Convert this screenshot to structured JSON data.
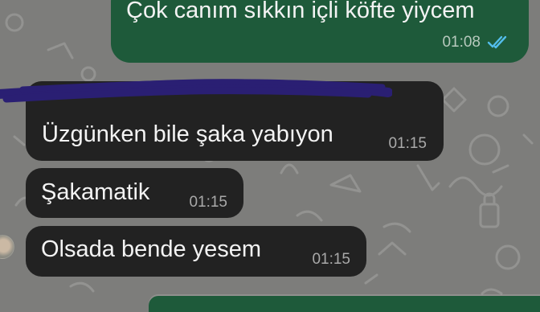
{
  "chat": {
    "messages": [
      {
        "direction": "outgoing",
        "text": "Çok canım sıkkın içli köfte yiycem",
        "time": "01:08",
        "status": "read"
      },
      {
        "direction": "incoming",
        "text": "Üzgünken bile şaka yabıyon",
        "time": "01:15"
      },
      {
        "direction": "incoming",
        "text": "Şakamatik",
        "time": "01:15"
      },
      {
        "direction": "incoming",
        "text": "Olsada bende yesem",
        "time": "01:15"
      }
    ]
  },
  "colors": {
    "background": "#7d7d7b",
    "outgoing_bubble": "#1e5a3a",
    "incoming_bubble": "#222222",
    "read_ticks": "#53bdeb",
    "scribble": "#2a1f73"
  },
  "icons": {
    "read_status": "double-check-icon"
  }
}
